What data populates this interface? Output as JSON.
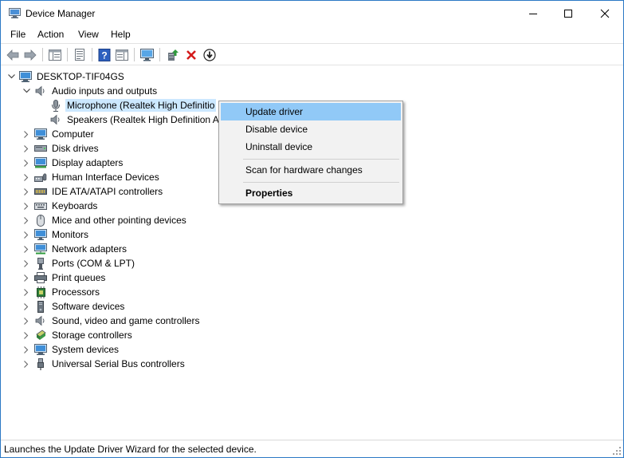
{
  "window": {
    "title": "Device Manager"
  },
  "menubar": {
    "items": [
      "File",
      "Action",
      "View",
      "Help"
    ]
  },
  "toolbar": {
    "buttons": [
      "back-arrow-icon",
      "forward-arrow-icon",
      "show-hide-console-tree-icon",
      "properties-sheet-icon",
      "help-icon",
      "action-pane-icon",
      "scan-hardware-icon",
      "update-driver-icon",
      "uninstall-device-icon",
      "download-arrow-icon"
    ]
  },
  "tree": {
    "root": "DESKTOP-TIF04GS",
    "audio": {
      "label": "Audio inputs and outputs",
      "children": [
        "Microphone (Realtek High Definitio",
        "Speakers (Realtek High Definition A"
      ]
    },
    "categories": [
      {
        "label": "Computer",
        "icon": "computer-icon"
      },
      {
        "label": "Disk drives",
        "icon": "disk-drive-icon"
      },
      {
        "label": "Display adapters",
        "icon": "display-adapter-icon"
      },
      {
        "label": "Human Interface Devices",
        "icon": "hid-icon"
      },
      {
        "label": "IDE ATA/ATAPI controllers",
        "icon": "ide-controller-icon"
      },
      {
        "label": "Keyboards",
        "icon": "keyboard-icon"
      },
      {
        "label": "Mice and other pointing devices",
        "icon": "mouse-icon"
      },
      {
        "label": "Monitors",
        "icon": "monitor-icon"
      },
      {
        "label": "Network adapters",
        "icon": "network-adapter-icon"
      },
      {
        "label": "Ports (COM & LPT)",
        "icon": "port-icon"
      },
      {
        "label": "Print queues",
        "icon": "printer-icon"
      },
      {
        "label": "Processors",
        "icon": "processor-icon"
      },
      {
        "label": "Software devices",
        "icon": "software-device-icon"
      },
      {
        "label": "Sound, video and game controllers",
        "icon": "speaker-icon"
      },
      {
        "label": "Storage controllers",
        "icon": "storage-controller-icon"
      },
      {
        "label": "System devices",
        "icon": "system-device-icon"
      },
      {
        "label": "Universal Serial Bus controllers",
        "icon": "usb-icon"
      }
    ]
  },
  "context_menu": {
    "update_driver": "Update driver",
    "disable_device": "Disable device",
    "uninstall_device": "Uninstall device",
    "scan_hardware": "Scan for hardware changes",
    "properties": "Properties"
  },
  "statusbar": {
    "text": "Launches the Update Driver Wizard for the selected device."
  },
  "colors": {
    "selection": "#cce8ff",
    "menu_hover": "#91c9f7",
    "window_border": "#2b78c5",
    "uninstall_red": "#d41b1b",
    "update_green": "#2e9a3c"
  }
}
